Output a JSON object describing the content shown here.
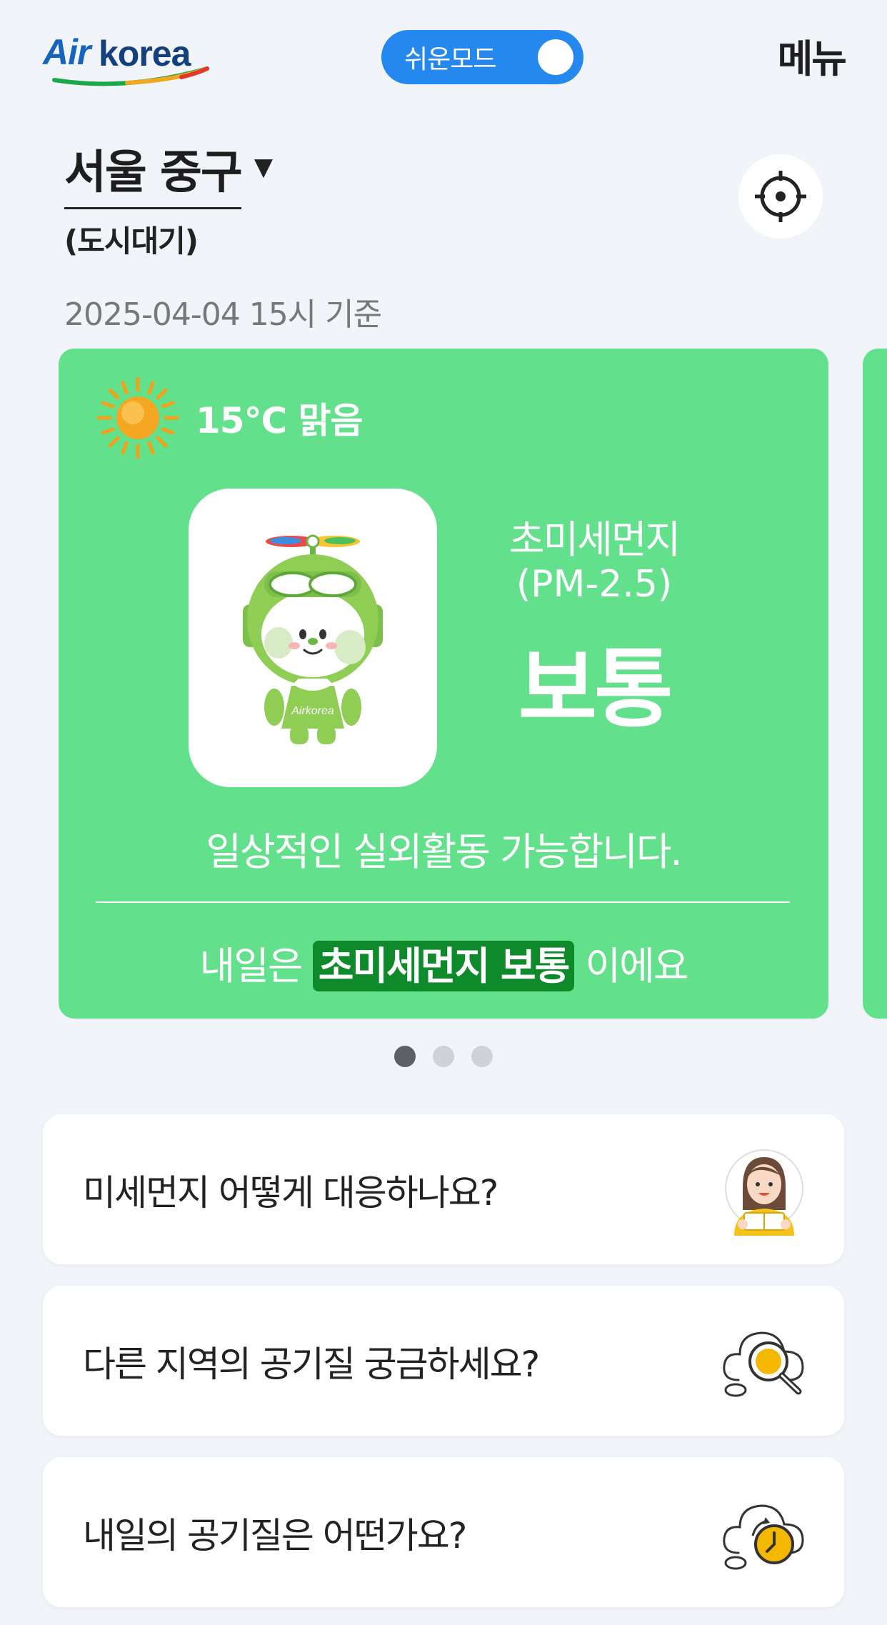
{
  "header": {
    "logo": {
      "air": "Air",
      "korea": "korea"
    },
    "easy_mode_label": "쉬운모드",
    "easy_mode_on": true,
    "menu_label": "메뉴"
  },
  "location": {
    "name": "서울 중구",
    "station_type": "(도시대기)",
    "timestamp": "2025-04-04 15시 기준"
  },
  "card": {
    "weather": "15℃ 맑음",
    "pollutant_name": "초미세먼지",
    "pollutant_code": "(PM-2.5)",
    "grade": "보통",
    "advice": "일상적인 실외활동 가능합니다.",
    "tomorrow_prefix": "내일은",
    "tomorrow_highlight": "초미세먼지 보통",
    "tomorrow_suffix": "이에요",
    "mascot_text": "Airkorea",
    "color": "#63e08b",
    "highlight_color": "#0e8a2b"
  },
  "pagination": {
    "total": 3,
    "current": 1
  },
  "info_cards": [
    {
      "question": "미세먼지 어떻게 대응하나요?",
      "icon": "person-reading-icon"
    },
    {
      "question": "다른 지역의 공기질 궁금하세요?",
      "icon": "cloud-search-icon"
    },
    {
      "question": "내일의 공기질은 어떤가요?",
      "icon": "cloud-clock-icon"
    }
  ]
}
